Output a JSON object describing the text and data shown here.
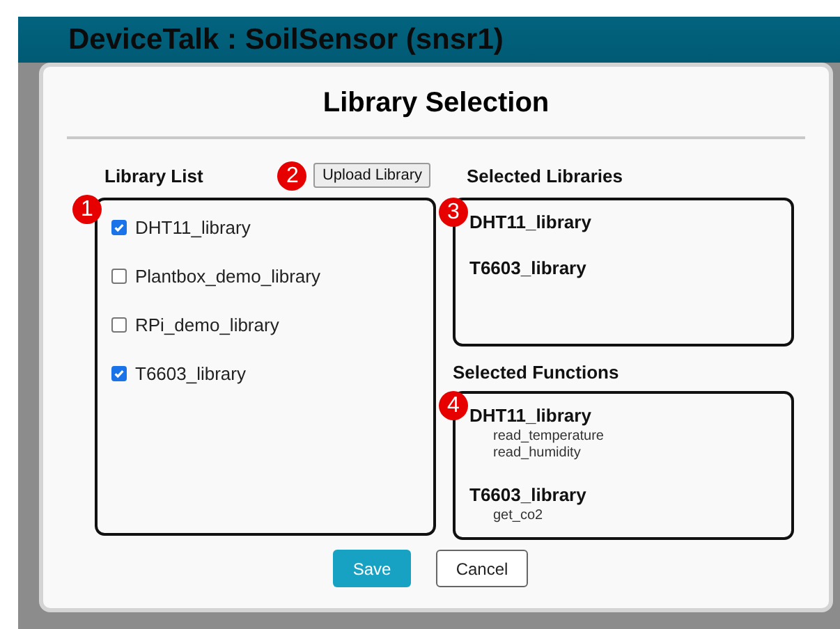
{
  "header": {
    "title": "DeviceTalk : SoilSensor (snsr1)"
  },
  "dialog": {
    "title": "Library Selection",
    "library_list": {
      "label": "Library List",
      "callout": "1",
      "items": [
        {
          "name": "DHT11_library",
          "checked": true
        },
        {
          "name": "Plantbox_demo_library",
          "checked": false
        },
        {
          "name": "RPi_demo_library",
          "checked": false
        },
        {
          "name": "T6603_library",
          "checked": true
        }
      ]
    },
    "upload_button": {
      "label": "Upload Library",
      "callout": "2"
    },
    "selected_libraries": {
      "label": "Selected Libraries",
      "callout": "3",
      "items": [
        "DHT11_library",
        "T6603_library"
      ]
    },
    "selected_functions": {
      "label": "Selected Functions",
      "callout": "4",
      "groups": [
        {
          "library": "DHT11_library",
          "functions": [
            "read_temperature",
            "read_humidity"
          ]
        },
        {
          "library": "T6603_library",
          "functions": [
            "get_co2"
          ]
        }
      ]
    },
    "buttons": [
      {
        "label": "Save",
        "kind": "primary"
      },
      {
        "label": "Cancel",
        "kind": "secondary"
      }
    ]
  }
}
